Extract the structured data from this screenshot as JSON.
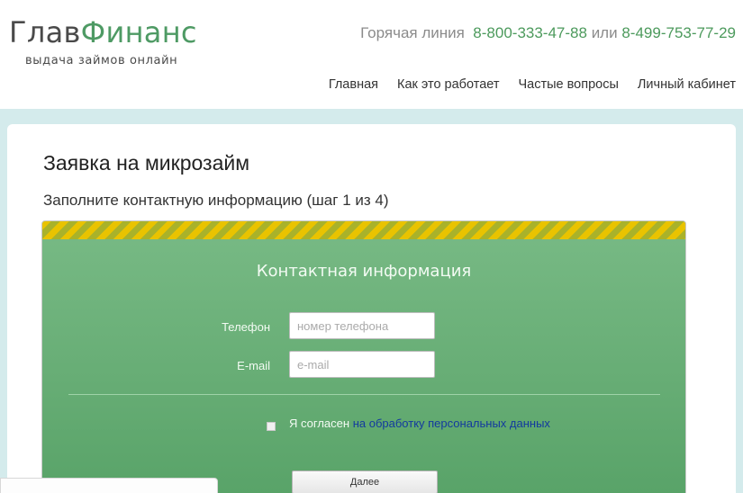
{
  "header": {
    "logo_part1": "Глав",
    "logo_part2": "Финанс",
    "tagline": "выдача займов онлайн",
    "hotline_label": "Горячая линия",
    "phone1": "8-800-333-47-88",
    "hotline_or": "или",
    "phone2": "8-499-753-77-29",
    "nav": [
      "Главная",
      "Как это работает",
      "Частые вопросы",
      "Личный кабинет"
    ]
  },
  "page": {
    "title": "Заявка на микрозайм",
    "subtitle": "Заполните контактную информацию (шаг 1 из 4)"
  },
  "form": {
    "title": "Контактная информация",
    "phone_label": "Телефон",
    "phone_placeholder": "номер телефона",
    "phone_value": "",
    "email_label": "E-mail",
    "email_placeholder": "e-mail",
    "email_value": "",
    "agree_text": "Я согласен",
    "agree_link": "на обработку персональных данных",
    "agree_checked": false,
    "next_label": "Далее"
  },
  "colors": {
    "brand_green": "#4e9a64",
    "form_green": "#67ad75",
    "stripe_yellow": "#e9c300",
    "link_blue": "#133a9e"
  }
}
